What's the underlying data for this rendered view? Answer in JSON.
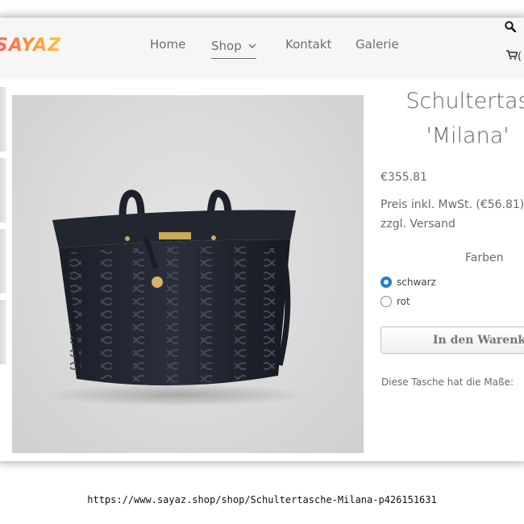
{
  "header": {
    "logo_text": "SAYAZ",
    "nav": [
      {
        "label": "Home"
      },
      {
        "label": "Shop",
        "active": true
      },
      {
        "label": "Kontakt"
      },
      {
        "label": "Galerie"
      }
    ],
    "search_icon": "search-icon",
    "cart_icon": "shopping-cart-icon",
    "cart_count": "(",
    "chevron_icon": "chevron-down-icon"
  },
  "gallery": {
    "thumbnail_count": 4,
    "main_image_alt": "handbag-photo"
  },
  "product": {
    "title_line1": "Schultertas",
    "title_line2": "'Milana'",
    "price": "€355.81",
    "tax_info": "Preis inkl. MwSt. (€56.81)",
    "shipping": "zzgl. Versand",
    "variants_label": "Farben",
    "variants": [
      {
        "label": "schwarz",
        "selected": true
      },
      {
        "label": "rot",
        "selected": false
      }
    ],
    "add_to_cart_label": "In den Warenko",
    "description": "Diese Tasche hat die Maße:"
  },
  "browser": {
    "url": "https://www.sayaz.shop/shop/Schultertasche-Milana-p426151631"
  },
  "colors": {
    "accent_blue": "#1e7fd6",
    "header_bg": "#f6f6f6",
    "logo_gradient": [
      "#ff5f5f",
      "#ffc23c"
    ]
  }
}
